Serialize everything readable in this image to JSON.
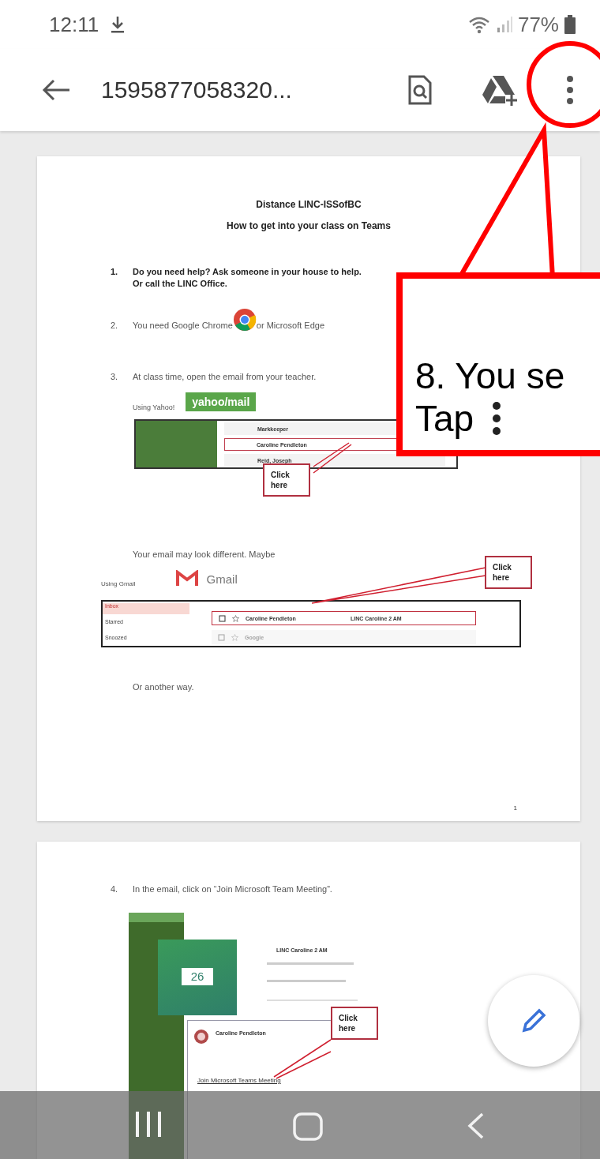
{
  "status_bar": {
    "time": "12:11",
    "battery": "77%"
  },
  "toolbar": {
    "title": "1595877058320..."
  },
  "page_1": {
    "title": "Distance LINC-ISSofBC",
    "subtitle": "How to get into your class on Teams",
    "step_1": {
      "number": "1.",
      "lines": [
        "Do you need help?  Ask someone in your house to help.",
        "Or call the LINC Office."
      ]
    },
    "step_2": {
      "number": "2.",
      "before": "You need Google Chrome",
      "after": "or Microsoft Edge"
    },
    "step_3": {
      "number": "3.",
      "text": "At class time, open the email from your teacher."
    },
    "yahoo": {
      "label": "Using Yahoo!",
      "logo": "yahoo/mail",
      "rows": [
        {
          "sender": "Markkeeper",
          "highlighted": false
        },
        {
          "sender": "Caroline Pendleton",
          "highlighted": true
        },
        {
          "sender": "Reid, Joseph",
          "highlighted": false
        }
      ],
      "note": "Click here"
    },
    "alt_text": "Your email may look different.  Maybe",
    "gmail": {
      "label": "Using Gmail",
      "logo": "Gmail",
      "folders": [
        {
          "name": "Inbox",
          "selected": true
        },
        {
          "name": "Starred",
          "selected": false
        },
        {
          "name": "Snoozed",
          "selected": false
        }
      ],
      "rows": [
        {
          "sender": "Caroline Pendleton",
          "subject": "LINC Caroline 2 AM",
          "highlighted": true
        },
        {
          "sender": "Google",
          "highlighted": false
        }
      ],
      "note": "Click here"
    },
    "other": "Or another way.",
    "page_number": "1"
  },
  "page_2": {
    "step_4": {
      "number": "4.",
      "text": "In the email, click on “Join Microsoft Team Meeting”."
    },
    "email": {
      "date": "26",
      "event_title": "LINC Caroline 2 AM",
      "sender": "Caroline Pendleton",
      "link": "Join Microsoft Teams Meeting",
      "note": "Click here"
    }
  },
  "callout": {
    "lines": [
      "8. You se",
      "Tap"
    ]
  }
}
